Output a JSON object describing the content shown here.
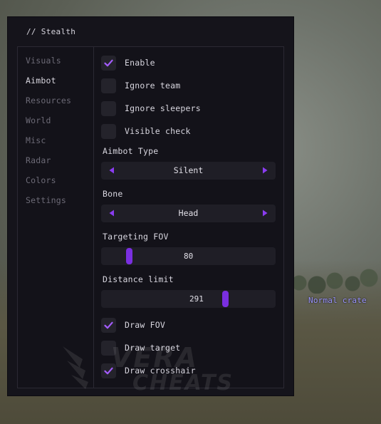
{
  "window": {
    "title": "// Stealth"
  },
  "sidebar": {
    "items": [
      {
        "label": "Visuals",
        "active": false
      },
      {
        "label": "Aimbot",
        "active": true
      },
      {
        "label": "Resources",
        "active": false
      },
      {
        "label": "World",
        "active": false
      },
      {
        "label": "Misc",
        "active": false
      },
      {
        "label": "Radar",
        "active": false
      },
      {
        "label": "Colors",
        "active": false
      },
      {
        "label": "Settings",
        "active": false
      }
    ]
  },
  "aimbot": {
    "enable": {
      "label": "Enable",
      "checked": true
    },
    "ignore_team": {
      "label": "Ignore team",
      "checked": false
    },
    "ignore_sleepers": {
      "label": "Ignore sleepers",
      "checked": false
    },
    "visible_check": {
      "label": "Visible check",
      "checked": false
    },
    "aimbot_type": {
      "label": "Aimbot Type",
      "value": "Silent"
    },
    "bone": {
      "label": "Bone",
      "value": "Head"
    },
    "targeting_fov": {
      "label": "Targeting FOV",
      "value": "80",
      "fraction": 0.16
    },
    "distance_limit": {
      "label": "Distance limit",
      "value": "291",
      "fraction": 0.71
    },
    "draw_fov": {
      "label": "Draw FOV",
      "checked": true
    },
    "draw_target": {
      "label": "Draw target",
      "checked": false
    },
    "draw_crosshair": {
      "label": "Draw crosshair",
      "checked": true
    }
  },
  "overlay": {
    "world_label": "Normal crate"
  },
  "watermark": {
    "line1": "VERA",
    "line2": "CHEATS"
  },
  "colors": {
    "accent": "#7a2fe0",
    "arrow": "#8a3cf0",
    "check": "#a45cff",
    "world_label": "#9b95ff"
  }
}
